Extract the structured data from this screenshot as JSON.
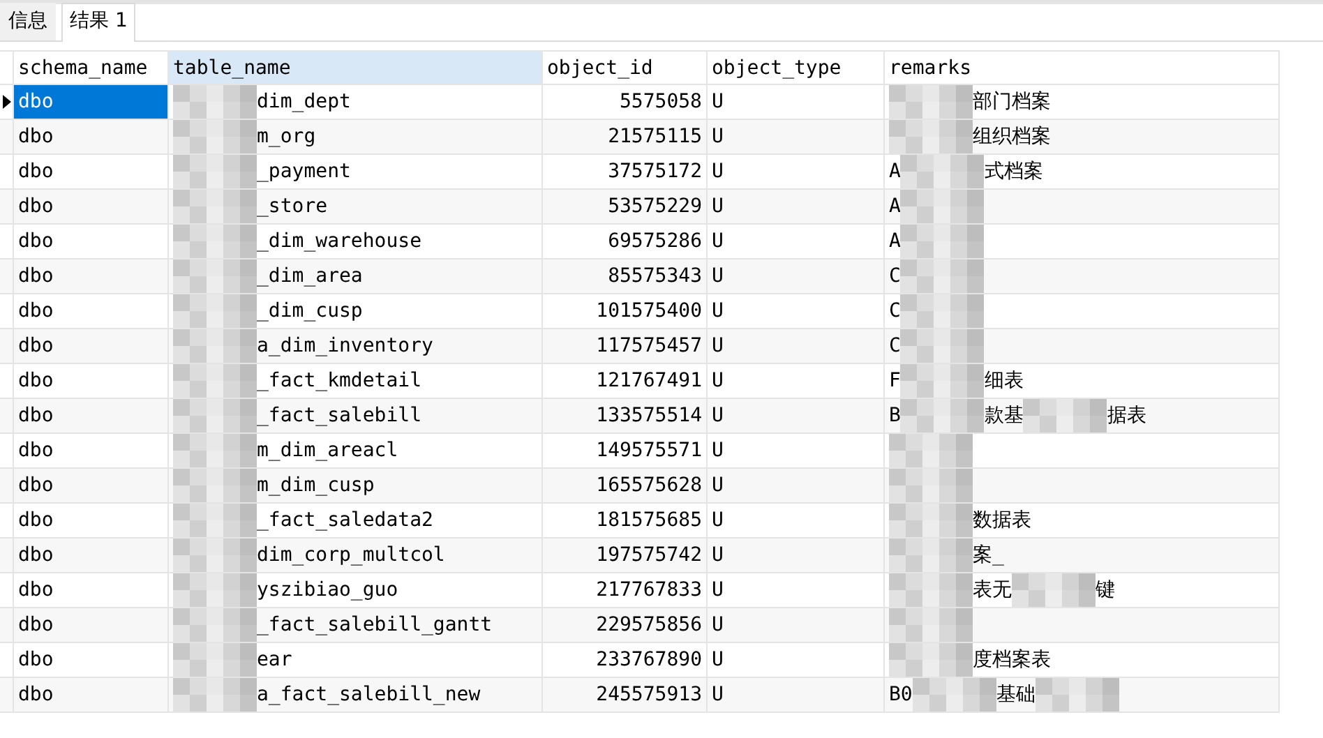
{
  "tabs": [
    {
      "label": "信息",
      "selected": false
    },
    {
      "label": "结果 1",
      "selected": true
    }
  ],
  "table": {
    "columns": [
      "schema_name",
      "table_name",
      "object_id",
      "object_type",
      "remarks"
    ],
    "rows": [
      {
        "selected": true,
        "schema_name": "dbo",
        "table_name": [
          {
            "kind": "mosaic"
          },
          {
            "kind": "text",
            "text": "dim_dept"
          }
        ],
        "object_id": "5575058",
        "object_type": "U",
        "remarks": [
          {
            "kind": "mosaic"
          },
          {
            "kind": "text",
            "text": "部门档案"
          }
        ]
      },
      {
        "selected": false,
        "schema_name": "dbo",
        "table_name": [
          {
            "kind": "mosaic"
          },
          {
            "kind": "text",
            "text": "m_org"
          }
        ],
        "object_id": "21575115",
        "object_type": "U",
        "remarks": [
          {
            "kind": "mosaic"
          },
          {
            "kind": "text",
            "text": "组织档案"
          }
        ]
      },
      {
        "selected": false,
        "schema_name": "dbo",
        "table_name": [
          {
            "kind": "mosaic"
          },
          {
            "kind": "text",
            "text": "_payment"
          }
        ],
        "object_id": "37575172",
        "object_type": "U",
        "remarks": [
          {
            "kind": "text",
            "text": "A"
          },
          {
            "kind": "mosaic"
          },
          {
            "kind": "text",
            "text": "式档案"
          }
        ]
      },
      {
        "selected": false,
        "schema_name": "dbo",
        "table_name": [
          {
            "kind": "mosaic"
          },
          {
            "kind": "text",
            "text": "_store"
          }
        ],
        "object_id": "53575229",
        "object_type": "U",
        "remarks": [
          {
            "kind": "text",
            "text": "A"
          },
          {
            "kind": "mosaic"
          }
        ]
      },
      {
        "selected": false,
        "schema_name": "dbo",
        "table_name": [
          {
            "kind": "mosaic"
          },
          {
            "kind": "text",
            "text": "_dim_warehouse"
          }
        ],
        "object_id": "69575286",
        "object_type": "U",
        "remarks": [
          {
            "kind": "text",
            "text": "A"
          },
          {
            "kind": "mosaic"
          }
        ]
      },
      {
        "selected": false,
        "schema_name": "dbo",
        "table_name": [
          {
            "kind": "mosaic"
          },
          {
            "kind": "text",
            "text": "_dim_area"
          }
        ],
        "object_id": "85575343",
        "object_type": "U",
        "remarks": [
          {
            "kind": "text",
            "text": "C"
          },
          {
            "kind": "mosaic"
          }
        ]
      },
      {
        "selected": false,
        "schema_name": "dbo",
        "table_name": [
          {
            "kind": "mosaic"
          },
          {
            "kind": "text",
            "text": "_dim_cusp"
          }
        ],
        "object_id": "101575400",
        "object_type": "U",
        "remarks": [
          {
            "kind": "text",
            "text": "C"
          },
          {
            "kind": "mosaic"
          }
        ]
      },
      {
        "selected": false,
        "schema_name": "dbo",
        "table_name": [
          {
            "kind": "mosaic"
          },
          {
            "kind": "text",
            "text": "a_dim_inventory"
          }
        ],
        "object_id": "117575457",
        "object_type": "U",
        "remarks": [
          {
            "kind": "text",
            "text": "C"
          },
          {
            "kind": "mosaic"
          }
        ]
      },
      {
        "selected": false,
        "schema_name": "dbo",
        "table_name": [
          {
            "kind": "mosaic"
          },
          {
            "kind": "text",
            "text": "_fact_kmdetail"
          }
        ],
        "object_id": "121767491",
        "object_type": "U",
        "remarks": [
          {
            "kind": "text",
            "text": "F"
          },
          {
            "kind": "mosaic"
          },
          {
            "kind": "text",
            "text": "细表"
          }
        ]
      },
      {
        "selected": false,
        "schema_name": "dbo",
        "table_name": [
          {
            "kind": "mosaic"
          },
          {
            "kind": "text",
            "text": "_fact_salebill"
          }
        ],
        "object_id": "133575514",
        "object_type": "U",
        "remarks": [
          {
            "kind": "text",
            "text": "B"
          },
          {
            "kind": "mosaic"
          },
          {
            "kind": "text",
            "text": "款基"
          },
          {
            "kind": "mosaic"
          },
          {
            "kind": "text",
            "text": "据表"
          }
        ]
      },
      {
        "selected": false,
        "schema_name": "dbo",
        "table_name": [
          {
            "kind": "mosaic"
          },
          {
            "kind": "text",
            "text": "m_dim_areacl"
          }
        ],
        "object_id": "149575571",
        "object_type": "U",
        "remarks": [
          {
            "kind": "mosaic"
          }
        ]
      },
      {
        "selected": false,
        "schema_name": "dbo",
        "table_name": [
          {
            "kind": "mosaic"
          },
          {
            "kind": "text",
            "text": "m_dim_cusp"
          }
        ],
        "object_id": "165575628",
        "object_type": "U",
        "remarks": [
          {
            "kind": "mosaic"
          }
        ]
      },
      {
        "selected": false,
        "schema_name": "dbo",
        "table_name": [
          {
            "kind": "mosaic"
          },
          {
            "kind": "text",
            "text": "_fact_saledata2"
          }
        ],
        "object_id": "181575685",
        "object_type": "U",
        "remarks": [
          {
            "kind": "mosaic"
          },
          {
            "kind": "text",
            "text": "数据表"
          }
        ]
      },
      {
        "selected": false,
        "schema_name": "dbo",
        "table_name": [
          {
            "kind": "mosaic"
          },
          {
            "kind": "text",
            "text": "dim_corp_multcol"
          }
        ],
        "object_id": "197575742",
        "object_type": "U",
        "remarks": [
          {
            "kind": "mosaic"
          },
          {
            "kind": "text",
            "text": "案_"
          }
        ]
      },
      {
        "selected": false,
        "schema_name": "dbo",
        "table_name": [
          {
            "kind": "mosaic"
          },
          {
            "kind": "text",
            "text": "yszibiao_guo"
          }
        ],
        "object_id": "217767833",
        "object_type": "U",
        "remarks": [
          {
            "kind": "mosaic"
          },
          {
            "kind": "text",
            "text": "表无"
          },
          {
            "kind": "mosaic"
          },
          {
            "kind": "text",
            "text": "键"
          }
        ]
      },
      {
        "selected": false,
        "schema_name": "dbo",
        "table_name": [
          {
            "kind": "mosaic"
          },
          {
            "kind": "text",
            "text": "_fact_salebill_gantt"
          }
        ],
        "object_id": "229575856",
        "object_type": "U",
        "remarks": [
          {
            "kind": "mosaic"
          }
        ]
      },
      {
        "selected": false,
        "schema_name": "dbo",
        "table_name": [
          {
            "kind": "mosaic"
          },
          {
            "kind": "text",
            "text": "ear"
          }
        ],
        "object_id": "233767890",
        "object_type": "U",
        "remarks": [
          {
            "kind": "mosaic"
          },
          {
            "kind": "text",
            "text": "度档案表"
          }
        ]
      },
      {
        "selected": false,
        "schema_name": "dbo",
        "table_name": [
          {
            "kind": "mosaic"
          },
          {
            "kind": "text",
            "text": "a_fact_salebill_new"
          }
        ],
        "object_id": "245575913",
        "object_type": "U",
        "remarks": [
          {
            "kind": "text",
            "text": "B0"
          },
          {
            "kind": "mosaic"
          },
          {
            "kind": "text",
            "text": "基础"
          },
          {
            "kind": "mosaic"
          }
        ]
      }
    ]
  }
}
